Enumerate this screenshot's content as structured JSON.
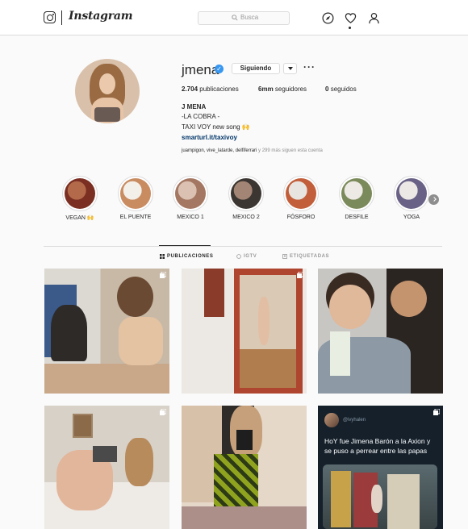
{
  "nav": {
    "logo_text": "Instagram",
    "search_placeholder": "Busca",
    "icons": [
      "explore-compass-icon",
      "activity-heart-icon",
      "profile-person-icon"
    ]
  },
  "profile": {
    "username": "jmena",
    "verified_mark": "✓",
    "follow_button": "Siguiendo",
    "more": "···",
    "stats": [
      {
        "value": "2.704",
        "label": "publicaciones"
      },
      {
        "value": "6mm",
        "label": "seguidores"
      },
      {
        "value": "0",
        "label": "seguidos"
      }
    ],
    "bio_name": "J MENA",
    "bio_lines": [
      "-LA COBRA -",
      "TAXI VOY new song 🙌"
    ],
    "bio_link": "smarturl.it/taxivoy",
    "followed_by_names": "juampigon, vive_latarde, delfiferrari",
    "followed_by_rest": " y 299 más siguen esta cuenta"
  },
  "highlights": [
    {
      "label": "VEGAN 🙌",
      "colors": [
        "#b36a4a",
        "#7a2f22"
      ]
    },
    {
      "label": "EL PUENTE",
      "colors": [
        "#f3efe9",
        "#c98c61"
      ]
    },
    {
      "label": "MEXICO 1",
      "colors": [
        "#dbc1b2",
        "#a47762"
      ]
    },
    {
      "label": "MEXICO 2",
      "colors": [
        "#a38575",
        "#3c3632"
      ]
    },
    {
      "label": "FÓSFORO",
      "colors": [
        "#e8e4df",
        "#c25f3a"
      ]
    },
    {
      "label": "DESFILE",
      "colors": [
        "#ede9e4",
        "#7b8a5a"
      ]
    },
    {
      "label": "YOGA",
      "colors": [
        "#ece8e6",
        "#6a6286"
      ]
    }
  ],
  "tabs": [
    {
      "label": "PUBLICACIONES",
      "icon": "grid-icon",
      "active": true
    },
    {
      "label": "IGTV",
      "icon": "igtv-icon",
      "active": false
    },
    {
      "label": "ETIQUETADAS",
      "icon": "tagged-icon",
      "active": false
    }
  ],
  "posts": [
    {
      "kind": "photo",
      "theme": "boy-and-woman-kitchen",
      "multi": true
    },
    {
      "kind": "photo",
      "theme": "mirror-selfie-hallway",
      "multi": true
    },
    {
      "kind": "photo",
      "theme": "boy-kiss-flowers",
      "multi": false
    },
    {
      "kind": "photo",
      "theme": "bed-pose",
      "multi": true
    },
    {
      "kind": "photo",
      "theme": "bathroom-pose",
      "multi": false
    },
    {
      "kind": "tweet",
      "handle": "@ivyhalen",
      "text": "HoY fue Jimena Barón a la Axion y se puso a perrear entre las papas",
      "multi": true
    }
  ]
}
